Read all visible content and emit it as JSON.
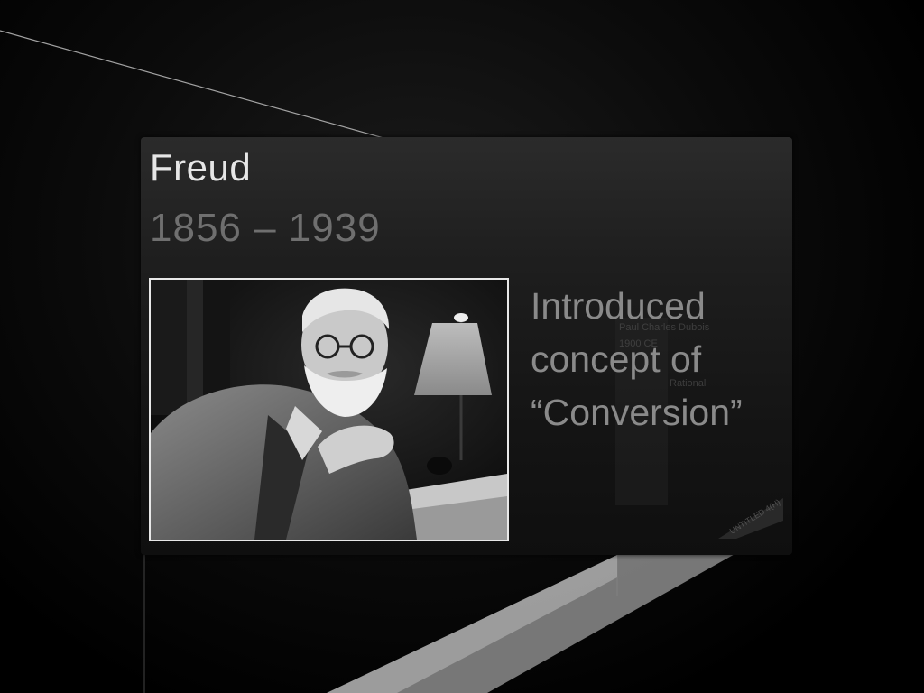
{
  "slide": {
    "title": "Freud",
    "subtitle": "1856 – 1939",
    "bullet": {
      "line1": "Introduced",
      "line2": "concept of",
      "line3": "“Conversion”"
    },
    "photo_alt": "Black and white portrait photograph"
  },
  "colors": {
    "background": "#000000",
    "panel": "#1e1e1e",
    "title": "#e6e6e6",
    "subtitle": "#6f6f6f",
    "bullet": "#8a8a8a",
    "photo_border": "#e8e8e8"
  }
}
